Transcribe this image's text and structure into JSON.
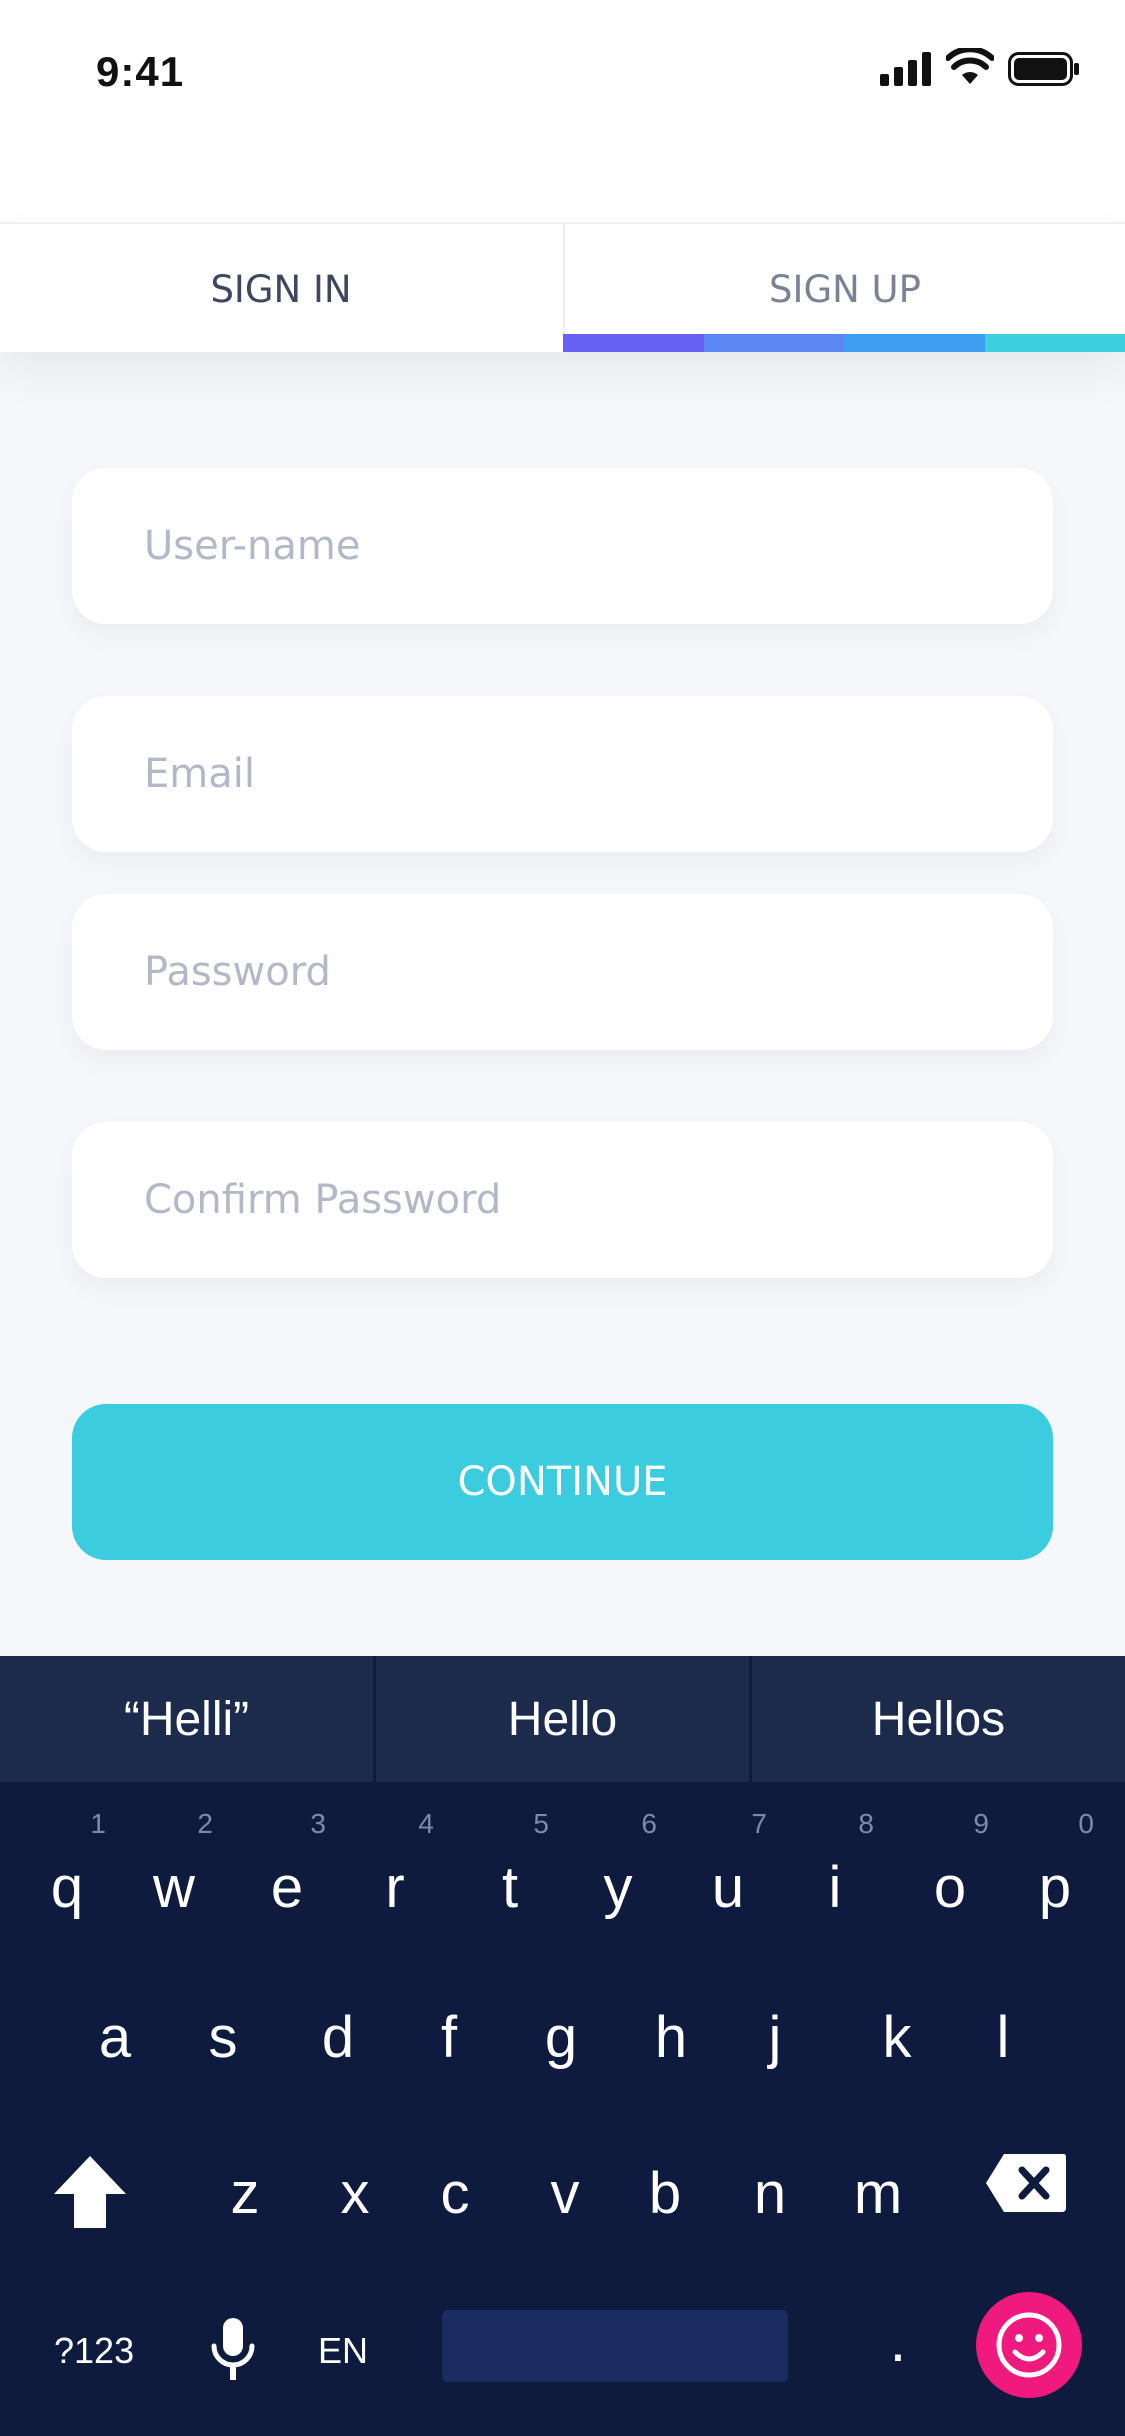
{
  "status_bar": {
    "time": "9:41"
  },
  "tabs": {
    "sign_in": "SIGN IN",
    "sign_up": "SIGN UP",
    "indicator_colors": [
      "#6760f2",
      "#5b86f3",
      "#3f9ef0",
      "#3ccfe0"
    ]
  },
  "form": {
    "username_placeholder": "User-name",
    "email_placeholder": "Email",
    "password_placeholder": "Password",
    "confirm_password_placeholder": "Confirm Password",
    "continue_label": "CONTINUE"
  },
  "colors": {
    "accent": "#3bcce0",
    "keyboard_bg": "#0e1b3e",
    "emoji_button": "#f0197d"
  },
  "keyboard": {
    "suggestions": [
      "“Helli”",
      "Hello",
      "Hellos"
    ],
    "row1": [
      {
        "key": "q",
        "num": "1"
      },
      {
        "key": "w",
        "num": "2"
      },
      {
        "key": "e",
        "num": "3"
      },
      {
        "key": "r",
        "num": "4"
      },
      {
        "key": "t",
        "num": "5"
      },
      {
        "key": "y",
        "num": "6"
      },
      {
        "key": "u",
        "num": "7"
      },
      {
        "key": "i",
        "num": "8"
      },
      {
        "key": "o",
        "num": "9"
      },
      {
        "key": "p",
        "num": "0"
      }
    ],
    "row2": [
      "a",
      "s",
      "d",
      "f",
      "g",
      "h",
      "j",
      "k",
      "l"
    ],
    "row3": [
      "z",
      "x",
      "c",
      "v",
      "b",
      "n",
      "m"
    ],
    "symbols_key": "?123",
    "language_key": "EN",
    "period_key": ".",
    "icons": {
      "shift": "shift-icon",
      "backspace": "backspace-icon",
      "mic": "microphone-icon",
      "emoji": "emoji-icon"
    }
  }
}
